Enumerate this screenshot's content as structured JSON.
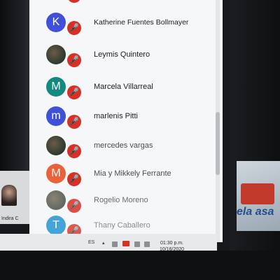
{
  "participants": [
    {
      "name": "Katherine Fuentes Bollmayer",
      "initial": "K",
      "color": "#3f51d9",
      "avatar": "letter"
    },
    {
      "name": "Leymis Quintero",
      "initial": "",
      "color": "",
      "avatar": "photo"
    },
    {
      "name": "Marcela Villarreal",
      "initial": "M",
      "color": "#138a80",
      "avatar": "letter"
    },
    {
      "name": "marlenis Pitti",
      "initial": "m",
      "color": "#3f51d9",
      "avatar": "letter"
    },
    {
      "name": "mercedes vargas",
      "initial": "",
      "color": "",
      "avatar": "photo"
    },
    {
      "name": "Mia y Mikkely Ferrante",
      "initial": "M",
      "color": "#e8623a",
      "avatar": "letter"
    },
    {
      "name": "Rogelio Moreno",
      "initial": "",
      "color": "",
      "avatar": "photo"
    },
    {
      "name": "Thany Caballero",
      "initial": "T",
      "color": "#1a8fcf",
      "avatar": "letter"
    }
  ],
  "mic_icon": "mic-muted-icon",
  "tile": {
    "label": "Indira C"
  },
  "taskbar": {
    "lang": "ES",
    "time": "01:30 p.m.",
    "date": "10/16/2020"
  },
  "poster": {
    "text": "ela asa"
  },
  "colors": {
    "mic_muted": "#d93025",
    "panel_bg": "#f6f7f8"
  }
}
